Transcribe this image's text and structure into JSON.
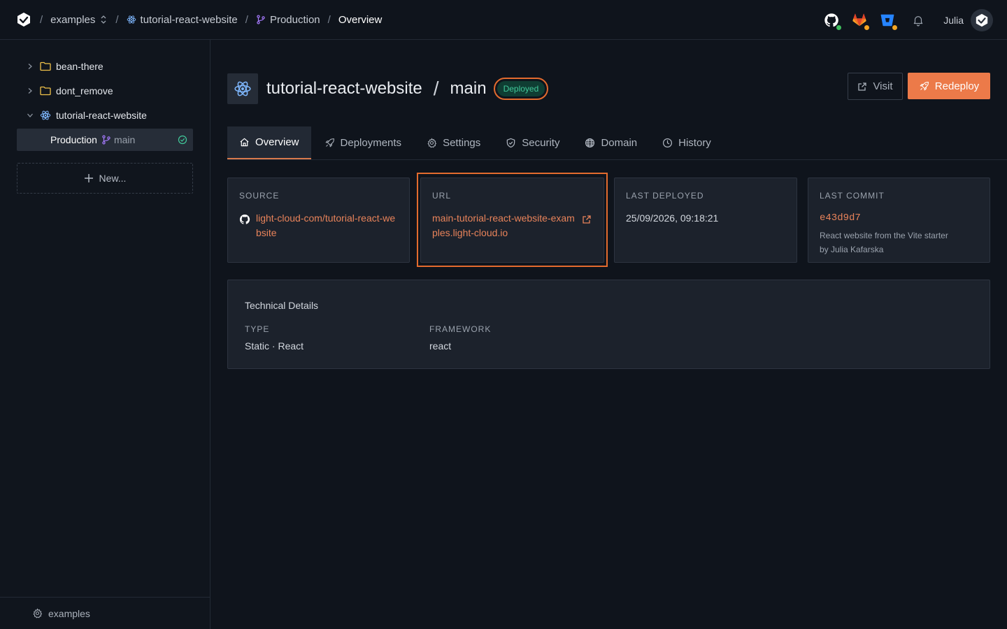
{
  "breadcrumb": {
    "org": "examples",
    "project": "tutorial-react-website",
    "environment": "Production",
    "page": "Overview"
  },
  "user": {
    "name": "Julia"
  },
  "colors": {
    "accent": "#ec7a49",
    "success": "#41c99a",
    "branch": "#a77bff",
    "react": "#7fb8ff"
  },
  "sidebar": {
    "items": [
      {
        "label": "bean-there",
        "icon": "folder-icon"
      },
      {
        "label": "dont_remove",
        "icon": "folder-icon"
      },
      {
        "label": "tutorial-react-website",
        "icon": "react-icon"
      }
    ],
    "selected": {
      "environment": "Production",
      "branch": "main"
    },
    "new_label": "New...",
    "footer_label": "examples"
  },
  "project": {
    "name": "tutorial-react-website",
    "branch": "main",
    "status": "Deployed"
  },
  "actions": {
    "visit": "Visit",
    "redeploy": "Redeploy"
  },
  "tabs": [
    {
      "label": "Overview",
      "icon": "home-icon"
    },
    {
      "label": "Deployments",
      "icon": "rocket-icon"
    },
    {
      "label": "Settings",
      "icon": "gear-icon"
    },
    {
      "label": "Security",
      "icon": "shield-icon"
    },
    {
      "label": "Domain",
      "icon": "globe-icon"
    },
    {
      "label": "History",
      "icon": "clock-icon"
    }
  ],
  "cards": {
    "source": {
      "label": "SOURCE",
      "value": "light-cloud-com/tutorial-react-website"
    },
    "url": {
      "label": "URL",
      "value": "main-tutorial-react-website-examples.light-cloud.io"
    },
    "last_deployed": {
      "label": "LAST DEPLOYED",
      "value": "25/09/2026, 09:18:21"
    },
    "last_commit": {
      "label": "LAST COMMIT",
      "hash": "e43d9d7",
      "message": "React website from the Vite starter",
      "author": "by Julia Kafarska"
    }
  },
  "technical": {
    "title": "Technical Details",
    "type_label": "TYPE",
    "type_value": "Static · React",
    "framework_label": "FRAMEWORK",
    "framework_value": "react"
  }
}
